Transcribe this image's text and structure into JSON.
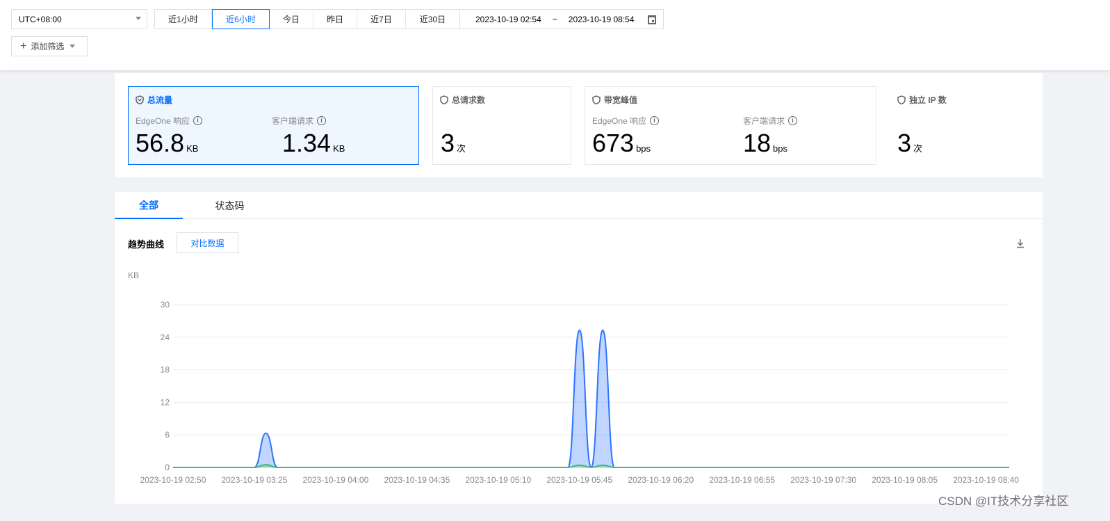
{
  "toolbar": {
    "timezone": "UTC+08:00",
    "ranges": [
      {
        "label": "近1小时",
        "active": false
      },
      {
        "label": "近6小时",
        "active": true
      },
      {
        "label": "今日",
        "active": false
      },
      {
        "label": "昨日",
        "active": false
      },
      {
        "label": "近7日",
        "active": false
      },
      {
        "label": "近30日",
        "active": false
      }
    ],
    "date_start": "2023-10-19 02:54",
    "date_sep": "~",
    "date_end": "2023-10-19 08:54",
    "add_filter": "添加筛选"
  },
  "stats": [
    {
      "title": "总流量",
      "selected": true,
      "metrics": [
        {
          "label": "EdgeOne 响应",
          "value": "56.8",
          "unit": "KB"
        },
        {
          "label": "客户端请求",
          "value": "1.34",
          "unit": "KB"
        }
      ]
    },
    {
      "title": "总请求数",
      "metrics": [
        {
          "value": "3",
          "unit": "次"
        }
      ]
    },
    {
      "title": "带宽峰值",
      "metrics": [
        {
          "label": "EdgeOne 响应",
          "value": "673",
          "unit": "bps"
        },
        {
          "label": "客户端请求",
          "value": "18",
          "unit": "bps"
        }
      ]
    },
    {
      "title": "独立 IP 数",
      "metrics": [
        {
          "value": "3",
          "unit": "次"
        }
      ]
    }
  ],
  "tabs": [
    {
      "label": "全部",
      "active": true
    },
    {
      "label": "状态码",
      "active": false
    }
  ],
  "trend_label": "趋势曲线",
  "compare_button": "对比数据",
  "colors": {
    "accent": "#006eff",
    "series_blue": "#2f74ff",
    "series_green": "#3cc160"
  },
  "chart_data": {
    "type": "area",
    "ylabel": "KB",
    "ylim": [
      0,
      30
    ],
    "yticks": [
      "0",
      "6",
      "12",
      "18",
      "24",
      "30"
    ],
    "xlim": [
      "2023-10-19 02:50",
      "2023-10-19 08:50"
    ],
    "xticks": [
      "2023-10-19 02:50",
      "2023-10-19 03:25",
      "2023-10-19 04:00",
      "2023-10-19 04:35",
      "2023-10-19 05:10",
      "2023-10-19 05:45",
      "2023-10-19 06:20",
      "2023-10-19 06:55",
      "2023-10-19 07:30",
      "2023-10-19 08:05",
      "2023-10-19 08:40"
    ],
    "grid": true,
    "series": [
      {
        "color": "#2f74ff",
        "points": [
          [
            "02:50",
            0
          ],
          [
            "03:25",
            0
          ],
          [
            "03:30",
            6.3
          ],
          [
            "03:35",
            0
          ],
          [
            "05:40",
            0
          ],
          [
            "05:45",
            25.3
          ],
          [
            "05:50",
            0
          ],
          [
            "05:55",
            25.3
          ],
          [
            "06:00",
            0
          ],
          [
            "08:50",
            0
          ]
        ]
      },
      {
        "color": "#3cc160",
        "points": [
          [
            "02:50",
            0
          ],
          [
            "03:25",
            0
          ],
          [
            "03:30",
            0.5
          ],
          [
            "03:35",
            0
          ],
          [
            "05:40",
            0
          ],
          [
            "05:45",
            0.42
          ],
          [
            "05:50",
            0
          ],
          [
            "05:55",
            0.42
          ],
          [
            "06:00",
            0
          ],
          [
            "08:50",
            0
          ]
        ]
      }
    ]
  },
  "watermark": "CSDN @IT技术分享社区"
}
